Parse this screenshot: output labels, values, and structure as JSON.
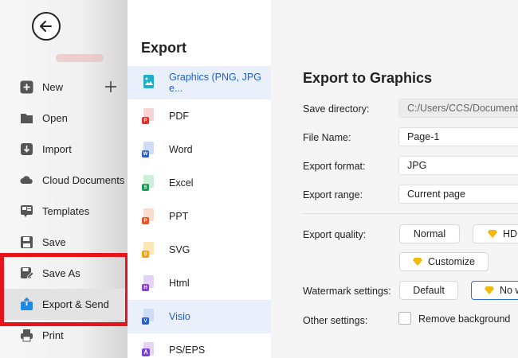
{
  "menu": {
    "items": [
      {
        "label": "New",
        "icon": "plus-square-icon"
      },
      {
        "label": "Open",
        "icon": "folder-icon"
      },
      {
        "label": "Import",
        "icon": "import-icon"
      },
      {
        "label": "Cloud Documents",
        "icon": "cloud-icon"
      },
      {
        "label": "Templates",
        "icon": "templates-icon"
      },
      {
        "label": "Save",
        "icon": "save-icon"
      },
      {
        "label": "Save As",
        "icon": "save-as-icon"
      },
      {
        "label": "Export & Send",
        "icon": "export-icon"
      },
      {
        "label": "Print",
        "icon": "print-icon"
      }
    ],
    "active": "Export & Send",
    "highlight_color": "#e8141b"
  },
  "export_list": {
    "title": "Export",
    "items": [
      {
        "label": "Graphics (PNG, JPG e...",
        "badge": "",
        "color": "#1fb0c9"
      },
      {
        "label": "PDF",
        "badge": "P",
        "color": "#e0332f"
      },
      {
        "label": "Word",
        "badge": "W",
        "color": "#2b62c9"
      },
      {
        "label": "Excel",
        "badge": "S",
        "color": "#1f9d55"
      },
      {
        "label": "PPT",
        "badge": "P",
        "color": "#e8542d"
      },
      {
        "label": "SVG",
        "badge": "S",
        "color": "#f0a21a"
      },
      {
        "label": "Html",
        "badge": "H",
        "color": "#8a3fd1"
      },
      {
        "label": "Visio",
        "badge": "V",
        "color": "#2b62c9"
      },
      {
        "label": "PS/EPS",
        "badge": "",
        "color": "#7b3fd1"
      }
    ],
    "selected": "Graphics (PNG, JPG e..."
  },
  "settings": {
    "title": "Export to Graphics",
    "save_directory_label": "Save directory:",
    "save_directory_value": "C:/Users/CCS/Documents",
    "file_name_label": "File Name:",
    "file_name_value": "Page-1",
    "export_format_label": "Export format:",
    "export_format_value": "JPG",
    "export_range_label": "Export range:",
    "export_range_value": "Current page",
    "quality_label": "Export quality:",
    "quality_normal": "Normal",
    "quality_hd": "HD",
    "quality_customize": "Customize",
    "watermark_label": "Watermark settings:",
    "watermark_default": "Default",
    "watermark_no": "No w",
    "other_label": "Other settings:",
    "remove_background": "Remove background",
    "remove_background_checked": false,
    "accent_color": "#2f6fe0",
    "premium_color": "#f2b90a"
  }
}
